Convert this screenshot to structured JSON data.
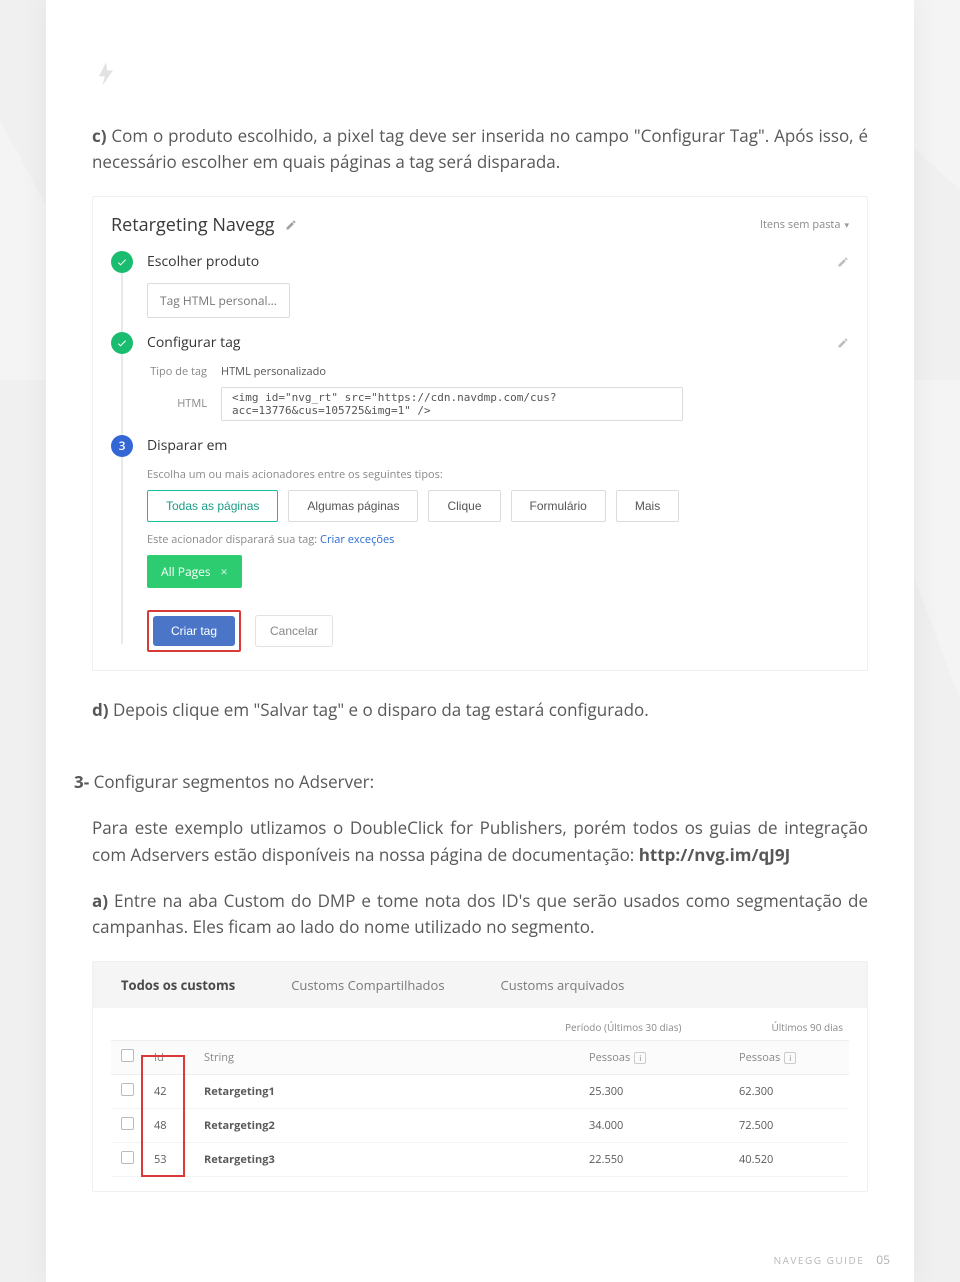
{
  "doc": {
    "footer_label": "NAVEGG GUIDE",
    "page_number": "05"
  },
  "paragraphs": {
    "c_bold": "c)",
    "c_text": " Com o produto escolhido, a pixel tag deve ser inserida no campo \"Configurar Tag\". Após isso, é necessário escolher em quais páginas a tag será disparada.",
    "d_bold": "d)",
    "d_text": " Depois clique em \"Salvar tag\" e o disparo da tag estará configurado.",
    "step3_bold": "3-",
    "step3_text": " Configurar segmentos no Adserver:",
    "p_adservers_pre": "Para este exemplo utlizamos o DoubleClick for Publishers, porém todos os guias de integração com Adservers estão disponíveis na nossa página de documentação: ",
    "p_adservers_url": "http://nvg.im/qJ9J",
    "a_bold": "a)",
    "a_text": " Entre na aba Custom do DMP e tome nota dos ID's que serão usados como segmentação de campanhas. Eles ficam ao lado do nome utilizado no segmento."
  },
  "gtm": {
    "title": "Retargeting Navegg",
    "breadcrumb": "Itens sem pasta",
    "step1_title": "Escolher produto",
    "step1_chip": "Tag HTML personal…",
    "step2_title": "Configurar tag",
    "step2_kv_type_label": "Tipo de tag",
    "step2_kv_type_value": "HTML personalizado",
    "step2_kv_html_label": "HTML",
    "step2_code": "<img id=\"nvg_rt\" src=\"https://cdn.navdmp.com/cus?acc=13776&cus=105725&img=1\" />",
    "step3_title": "Disparar em",
    "step3_help": "Escolha um ou mais acionadores entre os seguintes tipos:",
    "triggers": {
      "t1": "Todas as páginas",
      "t2": "Algumas páginas",
      "t3": "Clique",
      "t4": "Formulário",
      "t5": "Mais"
    },
    "step3_sentence_pre": "Este acionador disparará sua tag:  ",
    "step3_sentence_link": "Criar exceções",
    "chip_all": "All Pages",
    "btn_create": "Criar tag",
    "btn_cancel": "Cancelar",
    "badge3": "3"
  },
  "dmp": {
    "tabs": {
      "t1": "Todos os customs",
      "t2": "Customs Compartilhados",
      "t3": "Customs arquivados"
    },
    "period_left": "Período (Últimos 30 dias)",
    "period_right": "Últimos 90 dias",
    "headers": {
      "id": "Id",
      "string": "String",
      "pessoas1": "Pessoas",
      "pessoas2": "Pessoas"
    },
    "rows": [
      {
        "id": "42",
        "name": "Retargeting1",
        "p1": "25.300",
        "p2": "62.300"
      },
      {
        "id": "48",
        "name": "Retargeting2",
        "p1": "34.000",
        "p2": "72.500"
      },
      {
        "id": "53",
        "name": "Retargeting3",
        "p1": "22.550",
        "p2": "40.520"
      }
    ]
  }
}
